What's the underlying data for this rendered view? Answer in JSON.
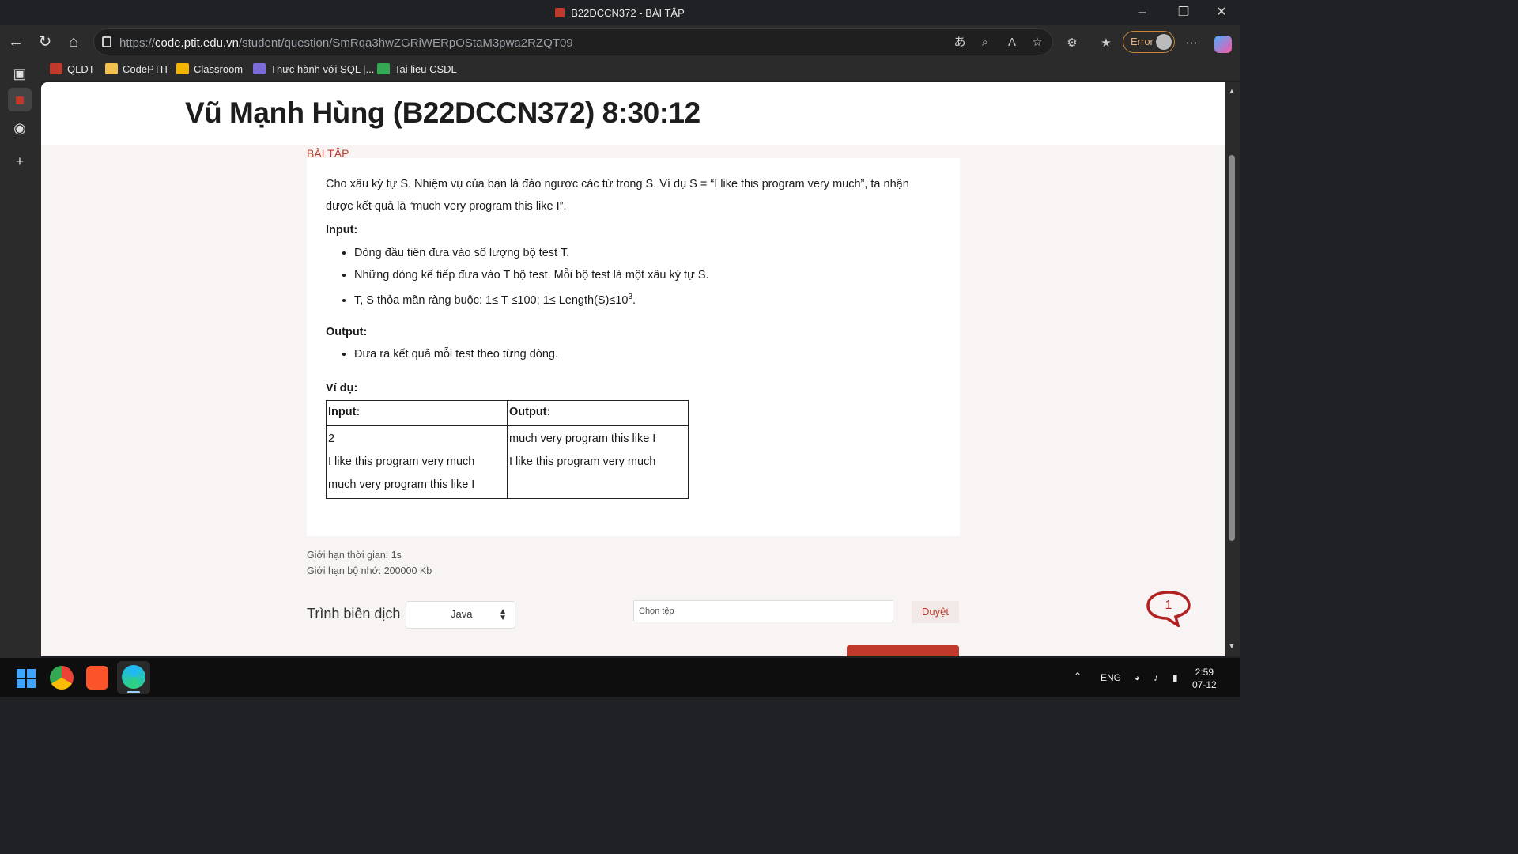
{
  "window": {
    "title": "B22DCCN372 - BÀI TẬP"
  },
  "browser": {
    "url_scheme": "https://",
    "url_host": "code.ptit.edu.vn",
    "url_path": "/student/question/SmRqa3hwZGRiWERpOStaM3pwa2RZQT09",
    "profile_label": "Error"
  },
  "bookmarks": [
    {
      "label": "QLDT",
      "color": "#c0392b"
    },
    {
      "label": "CodePTIT",
      "color": "#f2c14e"
    },
    {
      "label": "Classroom",
      "color": "#f4b400"
    },
    {
      "label": "Thực hành với SQL |...",
      "color": "#7b6cd9"
    },
    {
      "label": "Tai lieu CSDL",
      "color": "#34a853"
    }
  ],
  "header": {
    "title": "Vũ Mạnh Hùng (B22DCCN372) 8:30:12"
  },
  "breadcrumb": "BÀI TẬP",
  "problem": {
    "statement_line1": "Cho xâu ký tự S. Nhiệm vụ của bạn là đảo ngược các từ trong S. Ví dụ S =  “I like this program very much”, ta nhận",
    "statement_line2": "được kết quả là “much very program this like I”.",
    "input_heading": "Input:",
    "input_items": [
      "Dòng đầu tiên đưa vào số lượng bộ test T.",
      "Những dòng kế tiếp đưa vào T bộ test. Mỗi bộ test là một xâu ký tự S."
    ],
    "constraint_text": "T, S thỏa mãn ràng buộc: 1≤ T ≤100; 1≤ Length(S)≤10",
    "constraint_exp": "3",
    "constraint_end": ".",
    "output_heading": "Output:",
    "output_items": [
      "Đưa ra kết quả mỗi test theo từng dòng."
    ],
    "example_heading": "Ví dụ:",
    "example": {
      "headers": [
        "Input:",
        "Output:"
      ],
      "input_lines": [
        "2",
        "I like this program very much",
        "much very program this like I"
      ],
      "output_lines": [
        "much very program this like I",
        "I like this program very much"
      ]
    }
  },
  "limits": {
    "time": "Giới hạn thời gian: 1s",
    "memory": "Giới hạn bộ nhớ: 200000 Kb"
  },
  "submit_form": {
    "compiler_label": "Trình biên dịch",
    "language": "Java",
    "file_placeholder": "Chọn tệp",
    "browse_label": "Duyệt"
  },
  "chat": {
    "count": "1"
  },
  "taskbar": {
    "language": "ENG",
    "time": "2:59",
    "date": "07-12"
  }
}
